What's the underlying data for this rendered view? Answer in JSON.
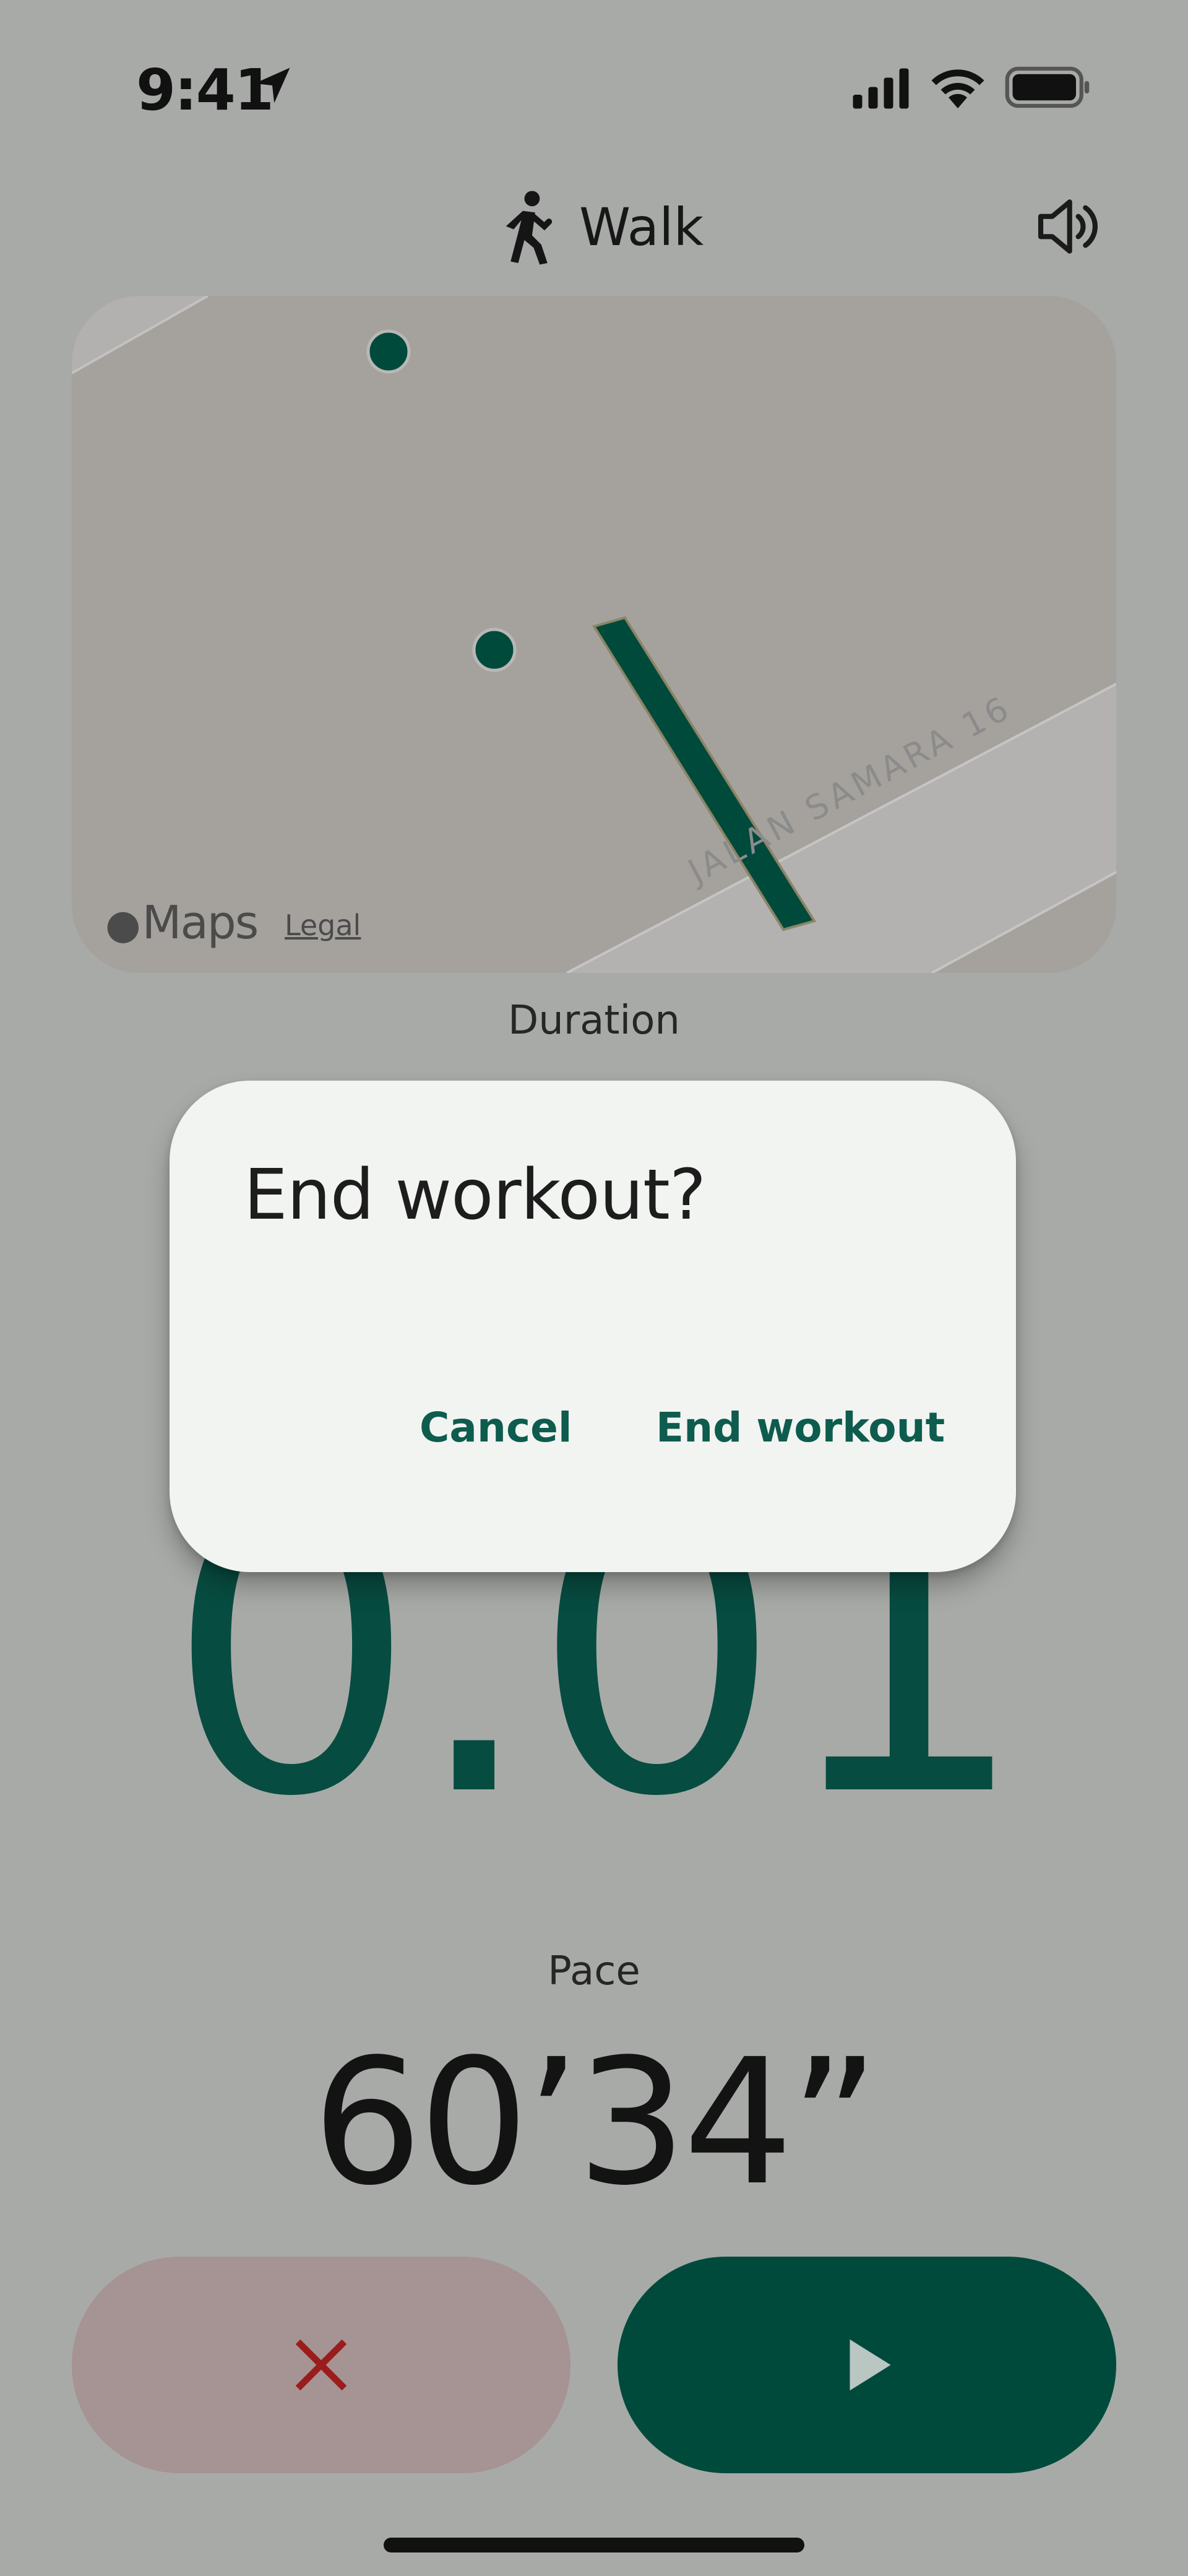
{
  "status_bar": {
    "time": "9:41",
    "icons": [
      "location-arrow-icon",
      "cellular-signal-icon",
      "wifi-icon",
      "battery-icon"
    ]
  },
  "header": {
    "title": "Walk",
    "activity_icon": "walk-icon",
    "sound_icon": "speaker-icon"
  },
  "map": {
    "brand": "Maps",
    "legal": "Legal",
    "street": "JALAN SAMARA 16",
    "route_color": "#004a3c"
  },
  "metrics": {
    "duration_label": "Duration",
    "distance_value": "0.01",
    "pace_label": "Pace",
    "pace_value": "60’34”"
  },
  "controls": {
    "end_icon": "close-icon",
    "resume_icon": "play-icon",
    "end_color": "#a69393",
    "end_icon_color": "#9b1c1c",
    "resume_color": "#004a3c"
  },
  "dialog": {
    "title": "End workout?",
    "cancel_label": "Cancel",
    "confirm_label": "End workout"
  },
  "colors": {
    "accent": "#0d5c4e",
    "background_dim": "#a8aaa7",
    "dialog_bg": "#f2f4f1"
  }
}
